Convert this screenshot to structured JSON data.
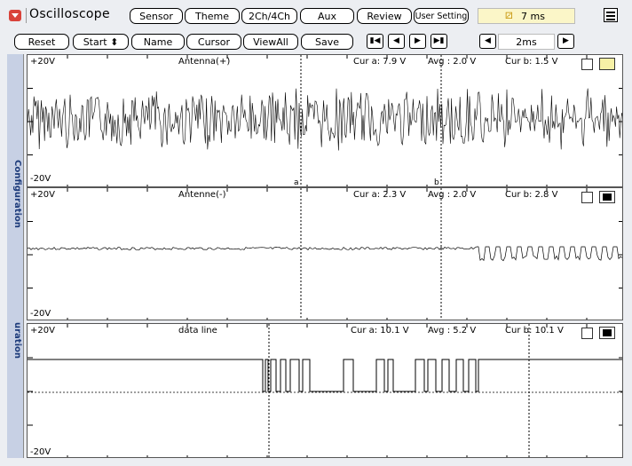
{
  "header": {
    "app_title": "Oscilloscope",
    "tabs": [
      "Sensor",
      "Theme",
      "2Ch/4Ch",
      "Aux",
      "Review",
      "User Setting"
    ],
    "timer": "7 ms"
  },
  "toolbar": {
    "buttons": [
      "Reset",
      "Start ⬍",
      "Name",
      "Cursor",
      "ViewAll",
      "Save"
    ],
    "nav": [
      "first",
      "prev",
      "next",
      "last"
    ],
    "zoom_value": "2ms"
  },
  "sidebar": {
    "tab_configuration": "Configuration",
    "tab_duration": "uration"
  },
  "panels": [
    {
      "top_label": "+20V",
      "bottom_label": "-20V",
      "name": "Antenna(+)",
      "cur_a": "Cur a: 7.9 V",
      "avg": "Avg  : 2.0 V",
      "cur_b": "Cur b: 1.5 V",
      "marker_a": "a",
      "marker_b": "b",
      "color": "#f7f1a6"
    },
    {
      "top_label": "+20V",
      "bottom_label": "-20V",
      "name": "Antenne(-)",
      "cur_a": "Cur a: 2.3 V",
      "avg": "Avg  : 2.0 V",
      "cur_b": "Cur b: 2.8 V",
      "color": "#000000"
    },
    {
      "top_label": "+20V",
      "bottom_label": "-20V",
      "name": "data line",
      "cur_a": "Cur a: 10.1 V",
      "avg": "Avg  : 5.2 V",
      "cur_b": "Cur b: 10.1 V",
      "color": "#000000"
    }
  ],
  "colors": {
    "accent": "#d9433a",
    "timer_bg": "#fbf6c8",
    "sidebar": "#c7d0e4"
  }
}
